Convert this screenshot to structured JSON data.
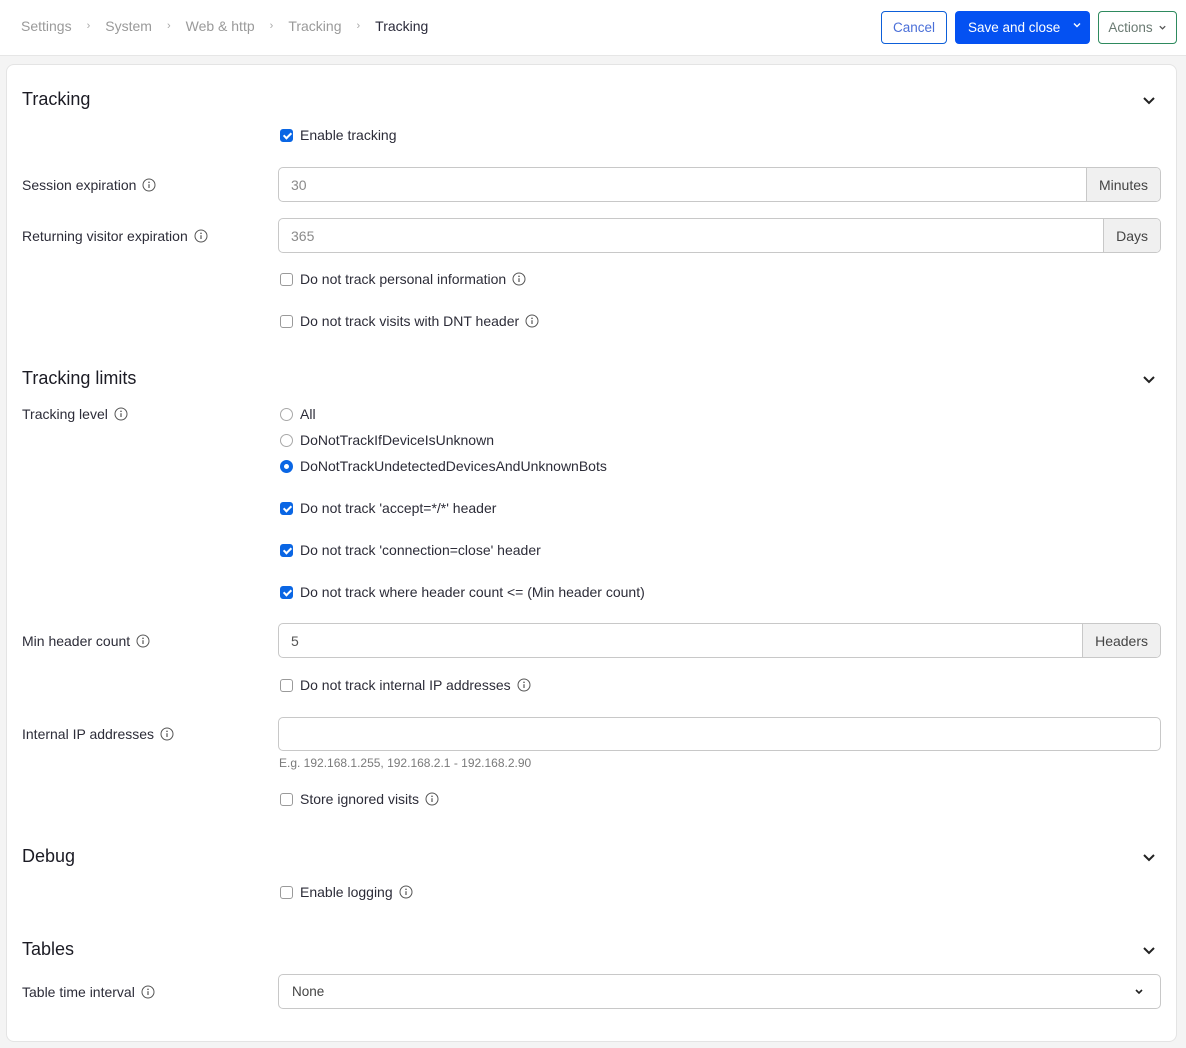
{
  "breadcrumb": [
    "Settings",
    "System",
    "Web & http",
    "Tracking",
    "Tracking"
  ],
  "toolbar": {
    "cancel_label": "Cancel",
    "save_label": "Save and close",
    "actions_label": "Actions"
  },
  "colors": {
    "primary": "#0451f2",
    "checkbox": "#0a66e4",
    "actions_border": "#2e8a5e"
  },
  "sections": {
    "tracking": {
      "title": "Tracking",
      "enable_tracking": {
        "label": "Enable tracking",
        "checked": true
      },
      "session_expiration": {
        "label": "Session expiration",
        "value": "30",
        "unit": "Minutes"
      },
      "returning_visitor_expiration": {
        "label": "Returning visitor expiration",
        "value": "365",
        "unit": "Days"
      },
      "no_personal_info": {
        "label": "Do not track personal information",
        "checked": false
      },
      "no_dnt": {
        "label": "Do not track visits with DNT header",
        "checked": false
      }
    },
    "limits": {
      "title": "Tracking limits",
      "tracking_level_label": "Tracking level",
      "tracking_levels": [
        {
          "label": "All",
          "selected": false
        },
        {
          "label": "DoNotTrackIfDeviceIsUnknown",
          "selected": false
        },
        {
          "label": "DoNotTrackUndetectedDevicesAndUnknownBots",
          "selected": true
        }
      ],
      "no_accept_header": {
        "label": "Do not track 'accept=*/*' header",
        "checked": true
      },
      "no_connection_close": {
        "label": "Do not track 'connection=close' header",
        "checked": true
      },
      "no_header_count": {
        "label": "Do not track where header count <= (Min header count)",
        "checked": true
      },
      "min_header_count": {
        "label": "Min header count",
        "value": "5",
        "unit": "Headers"
      },
      "no_internal_ip": {
        "label": "Do not track internal IP addresses",
        "checked": false
      },
      "internal_ip": {
        "label": "Internal IP addresses",
        "value": "",
        "hint": "E.g. 192.168.1.255, 192.168.2.1 - 192.168.2.90"
      },
      "store_ignored": {
        "label": "Store ignored visits",
        "checked": false
      }
    },
    "debug": {
      "title": "Debug",
      "enable_logging": {
        "label": "Enable logging",
        "checked": false
      }
    },
    "tables": {
      "title": "Tables",
      "table_time_interval": {
        "label": "Table time interval",
        "selected": "None"
      }
    }
  }
}
